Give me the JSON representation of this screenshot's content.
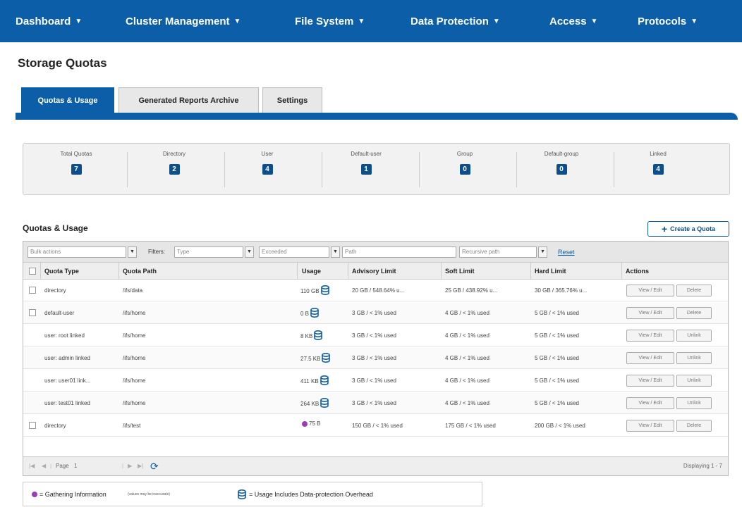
{
  "nav": [
    {
      "label": "Dashboard"
    },
    {
      "label": "Cluster Management"
    },
    {
      "label": "File System"
    },
    {
      "label": "Data Protection"
    },
    {
      "label": "Access"
    },
    {
      "label": "Protocols"
    }
  ],
  "page_title": "Storage Quotas",
  "tabs": [
    {
      "label": "Quotas & Usage",
      "active": true
    },
    {
      "label": "Generated Reports Archive",
      "active": false
    },
    {
      "label": "Settings",
      "active": false
    }
  ],
  "summary": [
    {
      "label": "Total Quotas",
      "value": "7"
    },
    {
      "label": "Directory",
      "value": "2"
    },
    {
      "label": "User",
      "value": "4"
    },
    {
      "label": "Default-user",
      "value": "1"
    },
    {
      "label": "Group",
      "value": "0"
    },
    {
      "label": "Default-group",
      "value": "0"
    },
    {
      "label": "Linked",
      "value": "4"
    }
  ],
  "section_title": "Quotas & Usage",
  "create_button": "Create a Quota",
  "filters": {
    "bulk_actions": "Bulk actions",
    "label": "Filters:",
    "type_placeholder": "Type",
    "exceeded_placeholder": "Exceeded",
    "path_placeholder": "Path",
    "recursive_placeholder": "Recursive path",
    "reset": "Reset"
  },
  "columns": [
    "Quota Type",
    "Quota Path",
    "Usage",
    "Advisory Limit",
    "Soft Limit",
    "Hard Limit",
    "Actions"
  ],
  "rows": [
    {
      "type": "directory",
      "path": "/ifs/data",
      "usage": "110 GB",
      "icon": "db",
      "advisory": "20 GB / 548.64% u...",
      "soft": "25 GB / 438.92% u...",
      "hard": "30 GB / 365.76% u...",
      "action1": "View / Edit",
      "action2": "Delete",
      "checkbox": true
    },
    {
      "type": "default-user",
      "path": "/ifs/home",
      "usage": "0 B",
      "icon": "db",
      "advisory": "3 GB / < 1% used",
      "soft": "4 GB / < 1% used",
      "hard": "5 GB / < 1% used",
      "action1": "View / Edit",
      "action2": "Delete",
      "checkbox": true
    },
    {
      "type": "user: root linked",
      "path": "/ifs/home",
      "usage": "8 KB",
      "icon": "db",
      "advisory": "3 GB / < 1% used",
      "soft": "4 GB / < 1% used",
      "hard": "5 GB / < 1% used",
      "action1": "View / Edit",
      "action2": "Unlink",
      "checkbox": false
    },
    {
      "type": "user: admin linked",
      "path": "/ifs/home",
      "usage": "27.5 KB",
      "icon": "db",
      "advisory": "3 GB / < 1% used",
      "soft": "4 GB / < 1% used",
      "hard": "5 GB / < 1% used",
      "action1": "View / Edit",
      "action2": "Unlink",
      "checkbox": false
    },
    {
      "type": "user: user01 link...",
      "path": "/ifs/home",
      "usage": "411 KB",
      "icon": "db",
      "advisory": "3 GB / < 1% used",
      "soft": "4 GB / < 1% used",
      "hard": "5 GB / < 1% used",
      "action1": "View / Edit",
      "action2": "Unlink",
      "checkbox": false
    },
    {
      "type": "user: test01 linked",
      "path": "/ifs/home",
      "usage": "264 KB",
      "icon": "db",
      "advisory": "3 GB / < 1% used",
      "soft": "4 GB / < 1% used",
      "hard": "5 GB / < 1% used",
      "action1": "View / Edit",
      "action2": "Unlink",
      "checkbox": false
    },
    {
      "type": "directory",
      "path": "/ifs/test",
      "usage": "75 B",
      "icon": "dot",
      "advisory": "150 GB / < 1% used",
      "soft": "175 GB / < 1% used",
      "hard": "200 GB / < 1% used",
      "action1": "View / Edit",
      "action2": "Delete",
      "checkbox": true
    }
  ],
  "pager": {
    "page_label": "Page",
    "page": "1",
    "displaying": "Displaying 1 - 7"
  },
  "legend": {
    "gathering": "= Gathering Information",
    "gathering_note": "(values may be inaccurate)",
    "overhead": "= Usage Includes Data-protection Overhead"
  },
  "colors": {
    "brand": "#0d5ea8",
    "gathering_dot": "#9b3db8"
  }
}
